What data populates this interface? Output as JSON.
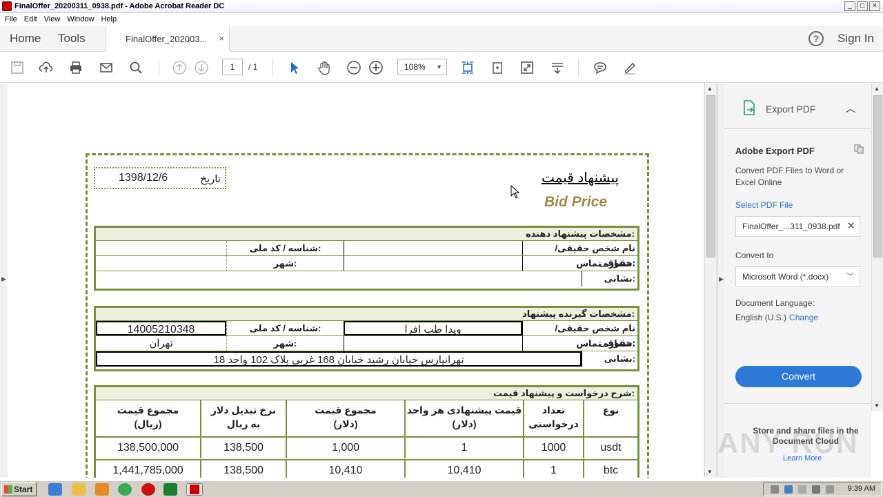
{
  "window": {
    "title": "FinalOffer_20200311_0938.pdf - Adobe Acrobat Reader DC",
    "buttons": [
      "_",
      "□",
      "×"
    ]
  },
  "menu": [
    "File",
    "Edit",
    "View",
    "Window",
    "Help"
  ],
  "nav": {
    "home": "Home",
    "tools": "Tools",
    "tab_label": "FinalOffer_202003...",
    "tab_close": "×",
    "help": "?",
    "sign_in": "Sign In"
  },
  "toolbar": {
    "page_current": "1",
    "page_total": "/ 1",
    "zoom": "108%"
  },
  "document": {
    "date_label": "تاریخ",
    "date_value": "1398/12/6",
    "title_fa": "پیشنهاد قیمت",
    "title_en": "Bid Price",
    "bidder": {
      "header": "مشخصات پیشنهاد دهنده:",
      "name_label": "نام شخص حقیقی/ حقوقی:",
      "id_label": "شناسه / کد ملی:",
      "phone_label": "شماره تماس:",
      "city_label": "شهر:",
      "address_label": "نشانی:"
    },
    "recipient": {
      "header": "مشخصات گیرنده پیشنهاد:",
      "name_label": "نام شخص حقیقی/ حقوقی:",
      "name_value": "ویدا طب افرا",
      "id_label": "شناسه / کد ملی:",
      "id_value": "14005210348",
      "phone_label": "شماره تماس:",
      "city_label": "شهر:",
      "city_value": "تهران",
      "address_label": "نشانی:",
      "address_value": "تهرانپارس خیابان رشید خیابان 168 غربی پلاک 102 واحد 18"
    },
    "pricing": {
      "header": "شرح درخواست و پیشنهاد قیمت:",
      "columns": [
        "نوع",
        "تعداد درخواستی",
        "قیمت پیشنهادی هر واحد (دلار)",
        "مجموع قیمت (دلار)",
        "نرخ تبدیل دلار به ریال",
        "مجموع قیمت (ریال)"
      ],
      "col_lines": [
        [
          "نوع",
          ""
        ],
        [
          "تعداد درخواستی",
          ""
        ],
        [
          "قیمت پیشنهادی هر واحد",
          "(دلار)"
        ],
        [
          "مجموع قیمت",
          "(دلار)"
        ],
        [
          "نرخ تبدیل دلار",
          "به ریال"
        ],
        [
          "مجموع قیمت",
          "(ریال)"
        ]
      ],
      "rows": [
        {
          "type": "usdt",
          "qty": "1000",
          "unit": "1",
          "total_usd": "1,000",
          "rate": "138,500",
          "total_rial": "138,500,000"
        },
        {
          "type": "btc",
          "qty": "1",
          "unit": "10,410",
          "total_usd": "10,410",
          "rate": "138,500",
          "total_rial": "1,441,785,000"
        }
      ]
    }
  },
  "export_panel": {
    "header": "Export PDF",
    "title": "Adobe Export PDF",
    "description": "Convert PDF Files to Word or Excel Online",
    "select_label": "Select PDF File",
    "file_name": "FinalOffer_...311_0938.pdf",
    "convert_to_label": "Convert to",
    "convert_to_value": "Microsoft Word (*.docx)",
    "language_label": "Document Language:",
    "language_value": "English (U.S.)",
    "language_change": "Change",
    "convert_button": "Convert",
    "store_text": "Store and share files in the Document Cloud",
    "learn_more": "Learn More"
  },
  "watermark": "ANY RUN",
  "taskbar": {
    "start": "Start",
    "clock": "9:39 AM"
  }
}
